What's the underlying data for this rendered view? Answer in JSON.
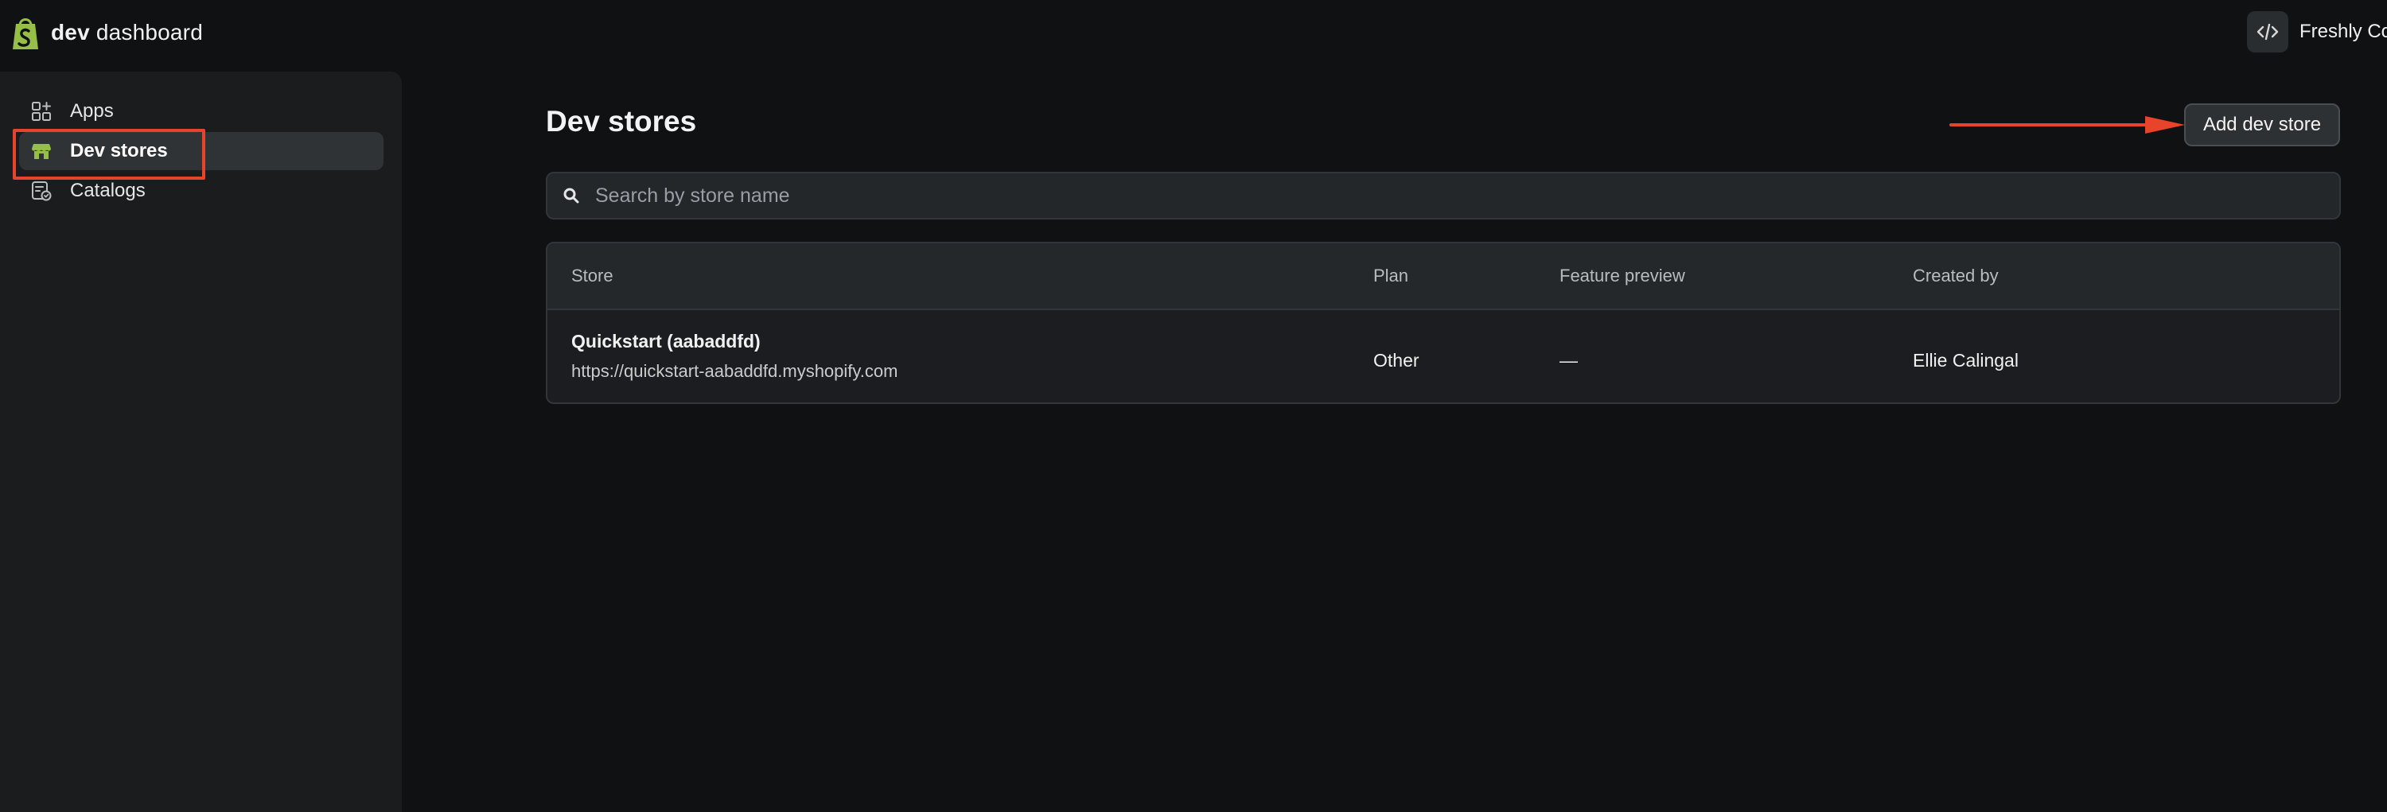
{
  "brand": {
    "name_strong": "dev",
    "name_rest": " dashboard",
    "accent": "#95bf47"
  },
  "org_switcher": {
    "icon": "code-icon",
    "name": "Freshly Coded"
  },
  "sidebar": {
    "items": [
      {
        "label": "Apps",
        "icon": "apps-icon",
        "active": false
      },
      {
        "label": "Dev stores",
        "icon": "store-icon",
        "active": true
      },
      {
        "label": "Catalogs",
        "icon": "catalog-icon",
        "active": false
      }
    ]
  },
  "main": {
    "title": "Dev stores",
    "add_button_label": "Add dev store",
    "search": {
      "placeholder": "Search by store name",
      "value": ""
    },
    "table": {
      "headers": [
        "Store",
        "Plan",
        "Feature preview",
        "Created by"
      ],
      "rows": [
        {
          "store_name": "Quickstart (aabaddfd)",
          "store_url": "https://quickstart-aabaddfd.myshopify.com",
          "plan": "Other",
          "feature_preview": "—",
          "created_by": "Ellie Calingal"
        }
      ]
    }
  },
  "annotation": {
    "color": "#e8432b"
  }
}
